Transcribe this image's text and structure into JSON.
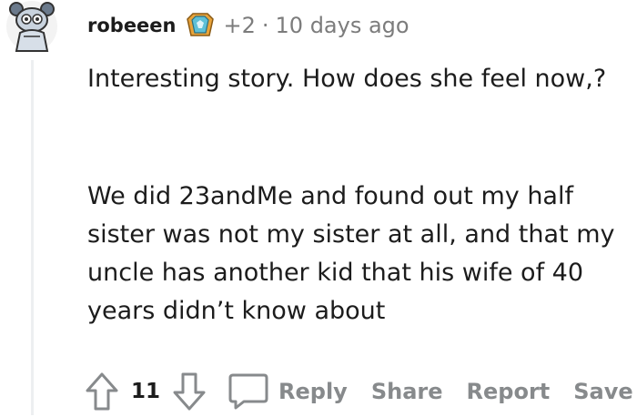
{
  "comment": {
    "username": "robeeen",
    "flair_icon": "achievement-badge-icon",
    "karma": "+2",
    "separator": "·",
    "timestamp": "10 days ago",
    "paragraphs": [
      "Interesting story. How does she feel now,?",
      "We did 23andMe and found out my half sister was not my sister at all, and that my uncle has another kid that his wife of 40 years didn’t know about"
    ],
    "score": "11",
    "actions": {
      "reply": "Reply",
      "share": "Share",
      "report": "Report",
      "save": "Save"
    }
  },
  "colors": {
    "text": "#1c1c1c",
    "muted": "#7c7c7c",
    "action": "#878a8c",
    "thread_line": "#edeff1"
  }
}
